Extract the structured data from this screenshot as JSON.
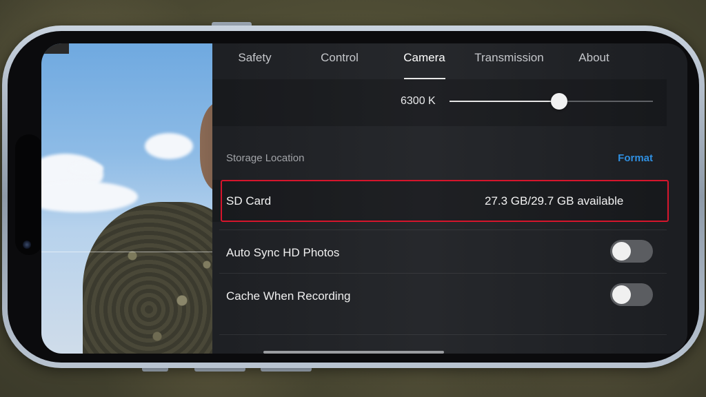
{
  "tabs": [
    {
      "label": "Safety",
      "active": false
    },
    {
      "label": "Control",
      "active": false
    },
    {
      "label": "Camera",
      "active": true
    },
    {
      "label": "Transmission",
      "active": false
    },
    {
      "label": "About",
      "active": false
    }
  ],
  "white_balance": {
    "value_label": "6300 K",
    "slider_level": 0.54
  },
  "storage": {
    "section_label": "Storage Location",
    "format_label": "Format",
    "sd_card_label": "SD Card",
    "sd_card_value": "27.3 GB/29.7 GB available"
  },
  "options": [
    {
      "label": "Auto Sync HD Photos",
      "enabled": false
    },
    {
      "label": "Cache When Recording",
      "enabled": false
    }
  ],
  "colors": {
    "accent": "#2f8fe0",
    "highlight_border": "#d6152c"
  }
}
